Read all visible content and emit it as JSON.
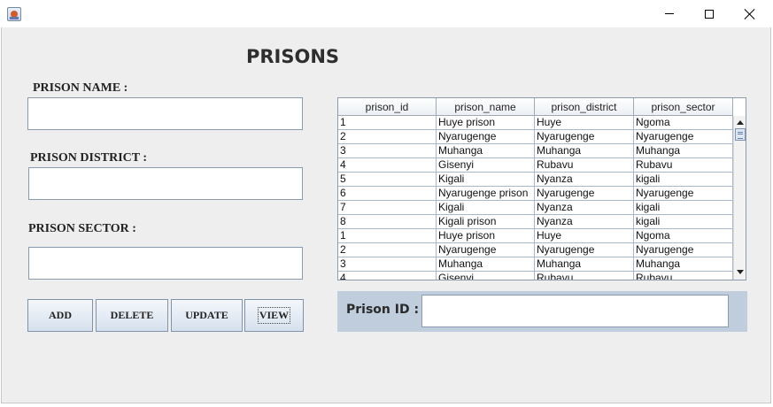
{
  "window": {
    "title": ""
  },
  "header": {
    "title": "PRISONS"
  },
  "form": {
    "name_label": "PRISON NAME :",
    "name_value": "",
    "district_label": "PRISON DISTRICT :",
    "district_value": "",
    "sector_label": "PRISON SECTOR :",
    "sector_value": ""
  },
  "buttons": {
    "add": "ADD",
    "delete": "DELETE",
    "update": "UPDATE",
    "view": "VIEW"
  },
  "table": {
    "columns": [
      "prison_id",
      "prison_name",
      "prison_district",
      "prison_sector"
    ],
    "rows": [
      [
        "1",
        "Huye prison",
        "Huye",
        "Ngoma"
      ],
      [
        "2",
        "Nyarugenge",
        "Nyarugenge",
        "Nyarugenge"
      ],
      [
        "3",
        "Muhanga",
        "Muhanga",
        "Muhanga"
      ],
      [
        "4",
        "Gisenyi",
        "Rubavu",
        "Rubavu"
      ],
      [
        "5",
        "Kigali",
        "Nyanza",
        "kigali"
      ],
      [
        "6",
        "Nyarugenge prison",
        "Nyarugenge",
        "Nyarugenge"
      ],
      [
        "7",
        "Kigali",
        "Nyanza",
        "kigali"
      ],
      [
        "8",
        "Kigali prison",
        "Nyanza",
        "kigali"
      ],
      [
        "1",
        "Huye prison",
        "Huye",
        "Ngoma"
      ],
      [
        "2",
        "Nyarugenge",
        "Nyarugenge",
        "Nyarugenge"
      ],
      [
        "3",
        "Muhanga",
        "Muhanga",
        "Muhanga"
      ],
      [
        "4",
        "Gisenyi",
        "Rubavu",
        "Rubavu"
      ]
    ]
  },
  "id_panel": {
    "label": "Prison ID :",
    "value": ""
  },
  "icons": {
    "app": "java-cup-icon",
    "minimize": "minimize-icon",
    "maximize": "maximize-icon",
    "close": "close-icon",
    "scroll_up": "arrow-up-icon",
    "scroll_down": "arrow-down-icon"
  },
  "colors": {
    "panel_background": "#eeeeee",
    "id_panel_background": "#bfcddc",
    "button_gradient_top": "#f4f7fb",
    "button_gradient_bottom": "#d6e1ee",
    "grid_line": "#a8b8cc"
  }
}
